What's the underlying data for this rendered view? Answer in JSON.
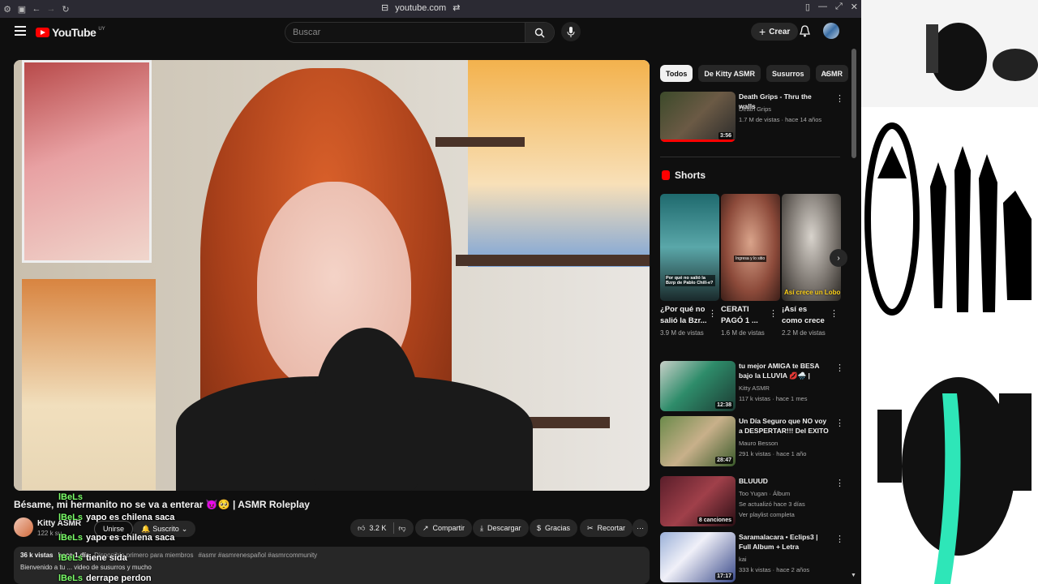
{
  "browser": {
    "url": "youtube.com"
  },
  "header": {
    "logo_text": "YouTube",
    "logo_country": "UY",
    "search_placeholder": "Buscar",
    "create_label": "Crear"
  },
  "video": {
    "title": "Bésame, mi hermanito no se va a enterar 😈🥺 | ASMR Roleplay",
    "channel": "Kitty ASMR",
    "subscribers": "122 k su",
    "join_label": "Unirse",
    "subscribed_label": "Suscrito",
    "likes": "3.2 K",
    "actions": {
      "share": "Compartir",
      "download": "Descargar",
      "thanks": "Gracias",
      "clip": "Recortar"
    },
    "description": {
      "views": "36 k vistas",
      "date": "hace 1 día",
      "members": "Disponible primero para miembros",
      "hashtags": "#asmr #asmrenespañol #asmrcommunity",
      "text": "Bienvenido a tu ... video de susurros y mucho"
    }
  },
  "overlay_chat": [
    {
      "user": "lBeLs",
      "message": ""
    },
    {
      "user": "lBeLs",
      "message": "yapo es chilena saca"
    },
    {
      "user": "lBeLs",
      "message": "yapo es chilena saca"
    },
    {
      "user": "lBeLs",
      "message": "tiene sida"
    },
    {
      "user": "lBeLs",
      "message": "derrape perdon"
    }
  ],
  "chips": [
    "Todos",
    "De Kitty ASMR",
    "Susurros",
    "ASMR"
  ],
  "shorts_title": "Shorts",
  "recommendations_top": {
    "title": "Death Grips - Thru the walls",
    "channel": "Death Grips",
    "meta": "1.7 M de vistas · hace 14 años",
    "duration": "3:56"
  },
  "shorts": [
    {
      "title": "¿Por qué no salió la Bzr...",
      "views": "3.9 M de vistas",
      "overlay": "Por qué no salió la Bzrp de Pablo Chill-e?"
    },
    {
      "title": "CERATI PAGÓ 1 ...",
      "views": "1.6 M de vistas",
      "overlay": "Ingresa y lo sitio"
    },
    {
      "title": "¡Así es como crece un ...",
      "views": "2.2 M de vistas",
      "overlay": "Así crece un Lobo"
    }
  ],
  "recommendations": [
    {
      "title": "tu mejor AMIGA te BESA bajo la LLUVIA 💋🌧️ | ASMR roleplay",
      "channel": "Kitty ASMR",
      "meta": "117 k vistas · hace 1 mes",
      "duration": "12:38"
    },
    {
      "title": "Un Día Seguro que NO voy a DESPERTAR!!! Del EXITO de su...",
      "channel": "Mauro Besson",
      "meta": "291 k vistas · hace 1 año",
      "duration": "28:47"
    },
    {
      "title": "BLUUUD",
      "channel": "Too Yugan · Álbum",
      "meta": "Se actualizó hace 3 días",
      "meta2": "Ver playlist completa",
      "duration": "8 canciones"
    },
    {
      "title": "Saramalacara • Eclips3 | Full Album + Letra",
      "channel": "kai",
      "meta": "333 k vistas · hace 2 años",
      "duration": "17:17"
    }
  ],
  "colors": {
    "accent": "#ff0000",
    "background": "#0f0f0f",
    "surface": "#272727",
    "chat_user": "#7cff6a"
  }
}
